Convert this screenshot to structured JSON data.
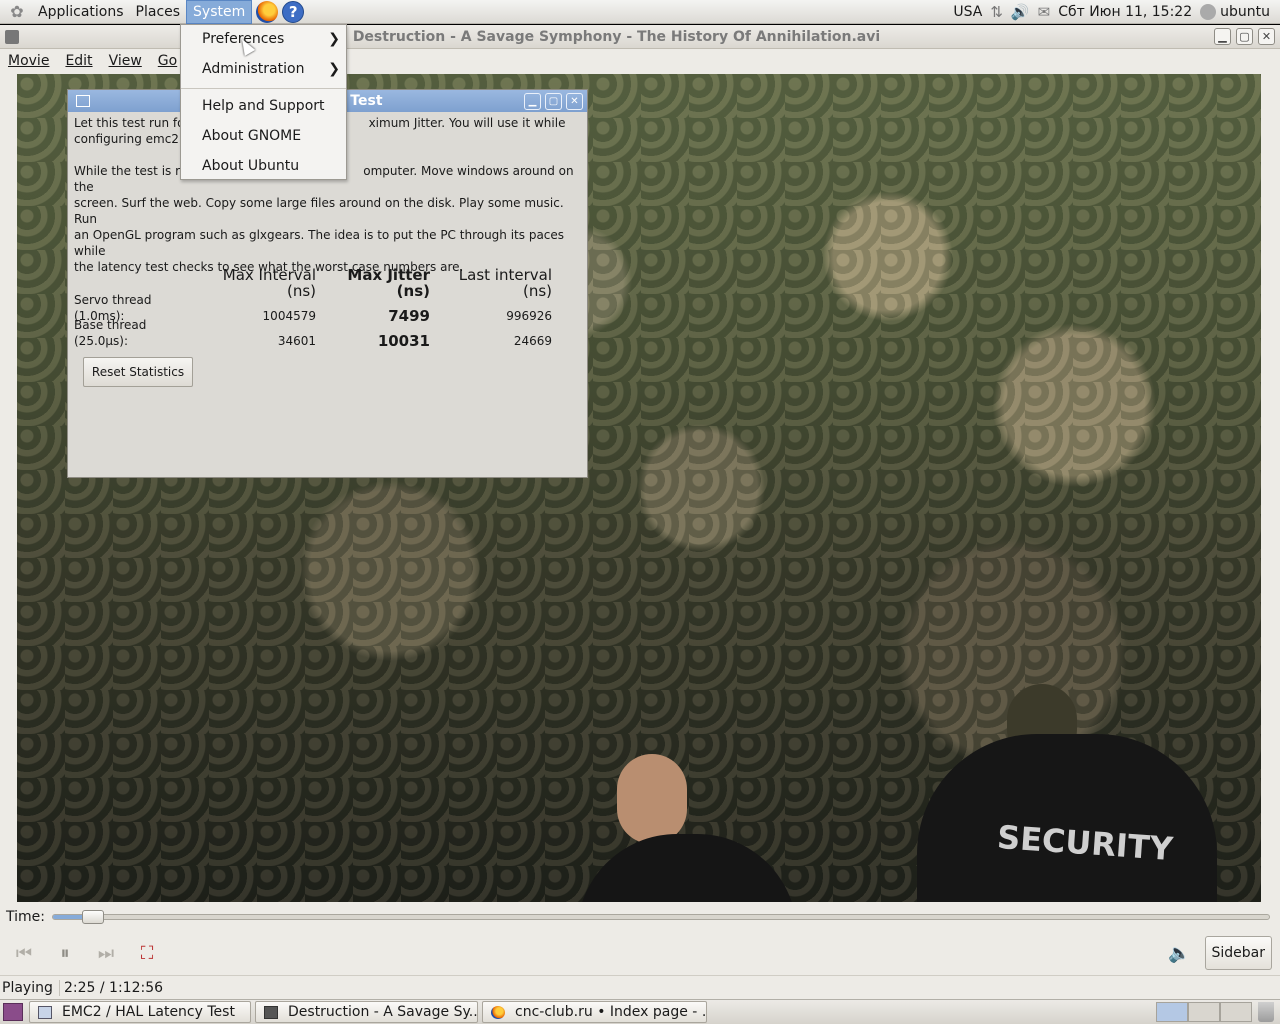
{
  "top_panel": {
    "menus": [
      "Applications",
      "Places",
      "System"
    ],
    "keyboard_layout": "USA",
    "datetime": "Сбт Июн 11, 15:22",
    "user": "ubuntu"
  },
  "player": {
    "title": "Destruction - A Savage Symphony - The History Of Annihilation.avi",
    "menu": [
      "Movie",
      "Edit",
      "View",
      "Go"
    ],
    "time_label": "Time:",
    "progress": 0.033,
    "sidebar_button": "Sidebar",
    "status": "Playing",
    "time_position": "2:25 / 1:12:56",
    "video_overlay_text": "SECURITY"
  },
  "latency_dialog": {
    "title": "cy Test",
    "para1_left": "Let this test run for a",
    "para1_right": "ximum Jitter.  You will use it while",
    "para1_line2": "configuring emc2.",
    "para2_line1_left": "While the test is run",
    "para2_line1_right": "omputer. Move windows around on the",
    "para2_line2": "screen. Surf the web. Copy some large files around on the disk. Play some music. Run",
    "para2_line3": "an OpenGL program such as glxgears. The idea is to put the PC through its paces while",
    "para2_line4": "the latency test checks to see what the worst case numbers are.",
    "headers": [
      "Max Interval (ns)",
      "Max Jitter (ns)",
      "Last interval (ns)"
    ],
    "rows": [
      {
        "label": "Servo thread (1.0ms):",
        "max_interval": "1004579",
        "max_jitter": "7499",
        "last_interval": "996926"
      },
      {
        "label": "Base thread (25.0µs):",
        "max_interval": "34601",
        "max_jitter": "10031",
        "last_interval": "24669"
      }
    ],
    "reset_button": "Reset Statistics"
  },
  "system_menu": {
    "items": [
      "Preferences",
      "Administration",
      "Help and Support",
      "About GNOME",
      "About Ubuntu"
    ]
  },
  "taskbar": {
    "tasks": [
      "EMC2 / HAL Latency Test",
      "Destruction - A Savage Sy...",
      "cnc-club.ru • Index page - ..."
    ]
  }
}
